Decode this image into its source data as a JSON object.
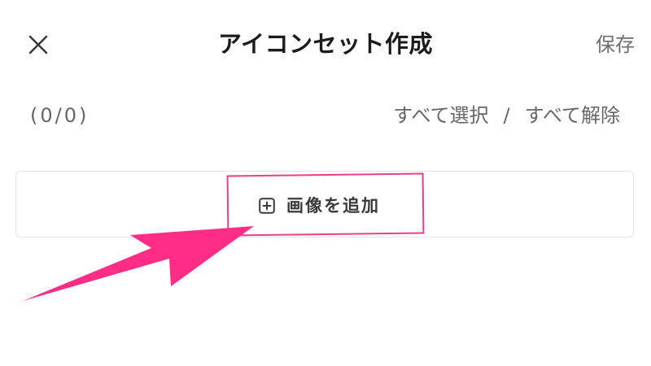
{
  "header": {
    "title": "アイコンセット作成",
    "save_label": "保存",
    "close_icon": "close-icon"
  },
  "selection": {
    "count": "(0/0)",
    "select_all": "すべて選択",
    "separator": "/",
    "deselect_all": "すべて解除"
  },
  "add_image": {
    "label": "画像を追加",
    "icon": "plus-square-icon"
  },
  "annotation": {
    "highlight_color": "#ea3f86",
    "arrow_color": "#ff2d86"
  }
}
